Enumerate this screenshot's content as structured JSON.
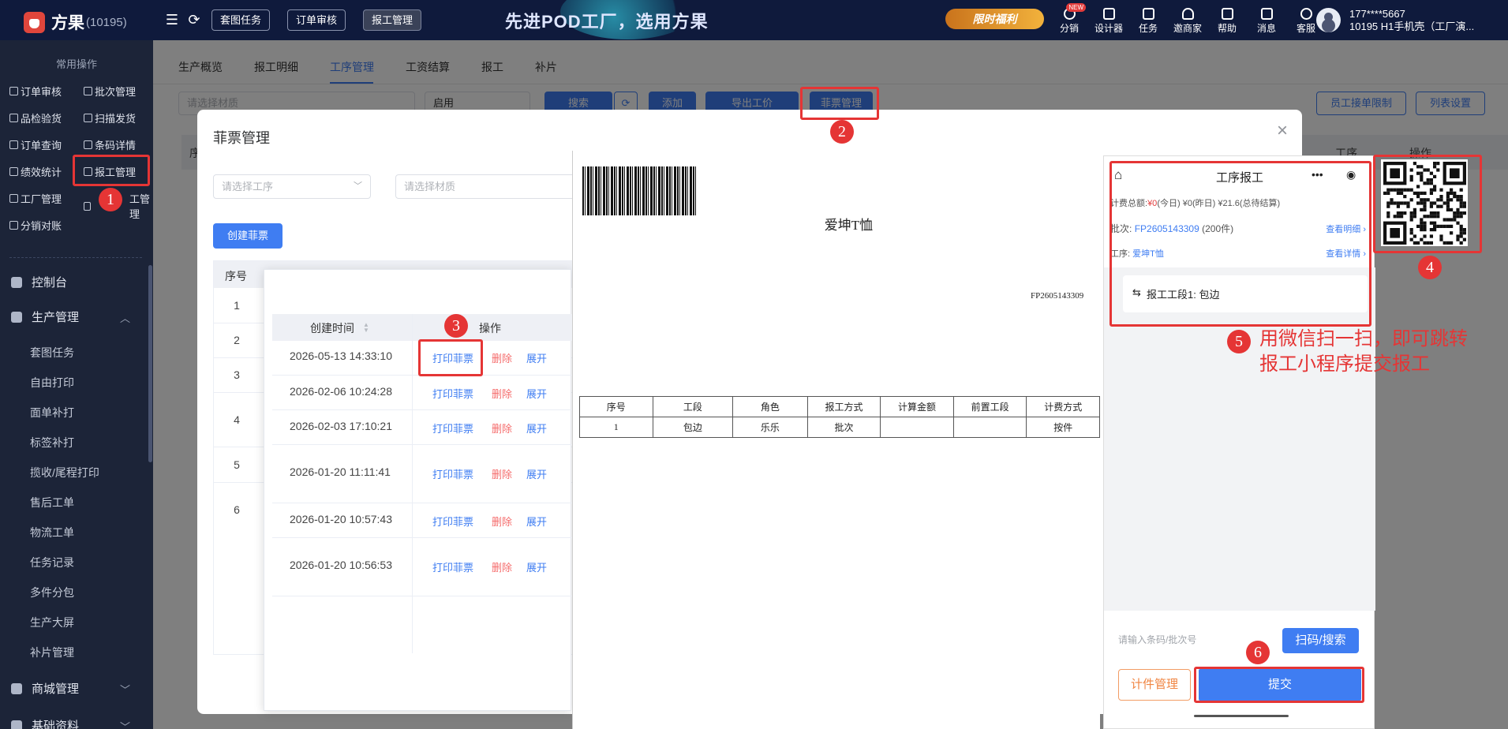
{
  "topbar": {
    "brand": "方果",
    "brand_count": "(10195)",
    "tabs": [
      "套图任务",
      "订单审核",
      "报工管理"
    ],
    "banner": "先进POD工厂，选用方果",
    "promo": "限时福利",
    "nav": [
      {
        "label": "分销",
        "badge": "NEW"
      },
      {
        "label": "设计器"
      },
      {
        "label": "任务"
      },
      {
        "label": "邀商家"
      },
      {
        "label": "帮助"
      },
      {
        "label": "消息"
      },
      {
        "label": "客服"
      }
    ],
    "user_phone": "177****5667",
    "user_store": "10195 H1手机壳（工厂演..."
  },
  "sidebar": {
    "quick_title": "常用操作",
    "quick": [
      "订单审核",
      "批次管理",
      "品检验货",
      "扫描发货",
      "订单查询",
      "条码详情",
      "绩效统计",
      "报工管理",
      "工厂管理",
      "工管理",
      "分销对账"
    ],
    "groups": [
      "控制台",
      "生产管理",
      "商城管理",
      "基础资料"
    ],
    "sub": [
      "套图任务",
      "自由打印",
      "面单补打",
      "标签补打",
      "揽收/尾程打印",
      "售后工单",
      "物流工单",
      "任务记录",
      "多件分包",
      "生产大屏",
      "补片管理"
    ]
  },
  "main": {
    "tabs": [
      "生产概览",
      "报工明细",
      "工序管理",
      "工资结算",
      "报工",
      "补片"
    ],
    "filter_material_placeholder": "请选择材质",
    "filter_status": "启用",
    "btn_search": "搜索",
    "btn_add": "添加",
    "btn_export": "导出工价",
    "btn_fp": "菲票管理",
    "btn_limit": "员工接单限制",
    "btn_cols": "列表设置",
    "col_seq": "序",
    "col_process": "工序",
    "col_op": "操作"
  },
  "dialog": {
    "title": "菲票管理",
    "close": "×",
    "select_process_placeholder": "请选择工序",
    "select_material_placeholder": "请选择材质",
    "create_btn": "创建菲票",
    "col_seq": "序号",
    "rows": [
      "1",
      "2",
      "3",
      "4",
      "5",
      "6"
    ]
  },
  "popup": {
    "col_time": "创建时间",
    "col_op": "操作",
    "ops": {
      "print": "打印菲票",
      "delete": "删除",
      "expand": "展开"
    },
    "rows": [
      "2026-05-13 14:33:10",
      "2026-02-06 10:24:28",
      "2026-02-03 17:10:21",
      "2026-01-20 11:11:41",
      "2026-01-20 10:57:43",
      "2026-01-20 10:56:53"
    ]
  },
  "preview": {
    "title": "爱坤T恤",
    "code": "FP2605143309",
    "headers": [
      "序号",
      "工段",
      "角色",
      "报工方式",
      "计算金额",
      "前置工段",
      "计费方式"
    ],
    "row": [
      "1",
      "包边",
      "乐乐",
      "批次",
      "",
      "",
      "按件"
    ]
  },
  "phone": {
    "title": "工序报工",
    "total_label": "计费总额:",
    "today_amount": "¥0",
    "today_label": "(今日)",
    "yesterday": "¥0(昨日)",
    "pending": "¥21.6(总待结算)",
    "batch_label": "批次:",
    "batch_code": "FP2605143309",
    "batch_count": "(200件)",
    "view_detail": "查看明细",
    "process_label": "工序:",
    "process_name": "爱坤T恤",
    "view_more": "查看详情",
    "section": "报工工段1: 包边",
    "input_placeholder": "请输入条码/批次号",
    "scan_btn": "扫码/搜索",
    "count_btn": "计件管理",
    "submit_btn": "提交"
  },
  "annotations": {
    "steps": [
      "1",
      "2",
      "3",
      "4",
      "5",
      "6"
    ],
    "note_line1": "用微信扫一扫，即可跳转",
    "note_line2": "报工小程序提交报工",
    "color": "#e53535"
  }
}
